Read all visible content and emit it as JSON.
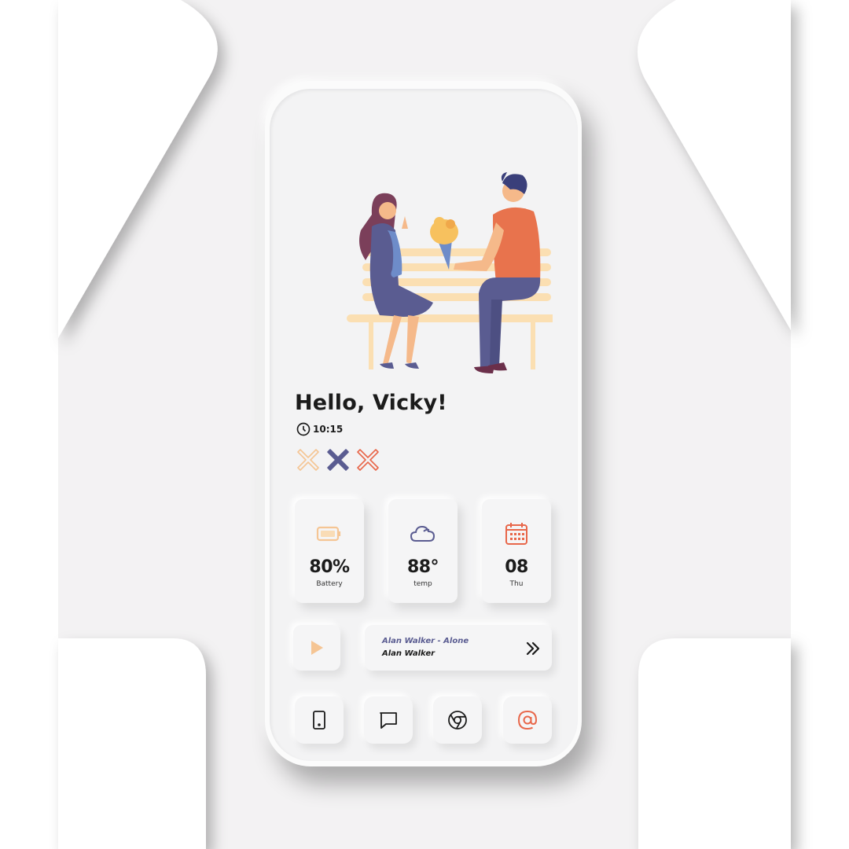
{
  "greeting": "Hello, Vicky!",
  "clock": {
    "icon": "clock-icon",
    "time": "10:15"
  },
  "status_marks": [
    {
      "icon": "x-outline-icon",
      "color": "#f5c594"
    },
    {
      "icon": "x-filled-icon",
      "color": "#5a5c91"
    },
    {
      "icon": "x-outline-icon",
      "color": "#e8674a"
    }
  ],
  "widgets": [
    {
      "icon": "battery-icon",
      "value": "80%",
      "label": "Battery",
      "color": "#f5c594"
    },
    {
      "icon": "cloud-icon",
      "value": "88°",
      "label": "temp",
      "color": "#5a5c91"
    },
    {
      "icon": "calendar-icon",
      "value": "08",
      "label": "Thu",
      "color": "#e8674a"
    }
  ],
  "music": {
    "title": "Alan Walker - Alone",
    "artist": "Alan Walker",
    "play_icon": "play-icon",
    "next_icon": "double-chevron-right-icon"
  },
  "dock": [
    {
      "icon": "phone-icon"
    },
    {
      "icon": "message-icon"
    },
    {
      "icon": "chrome-icon"
    },
    {
      "icon": "at-sign-icon",
      "color": "#e8674a"
    }
  ],
  "colors": {
    "accent_blue": "#5a5c91",
    "accent_orange": "#e8674a",
    "accent_peach": "#f5c594",
    "background": "#f3f2f3"
  }
}
